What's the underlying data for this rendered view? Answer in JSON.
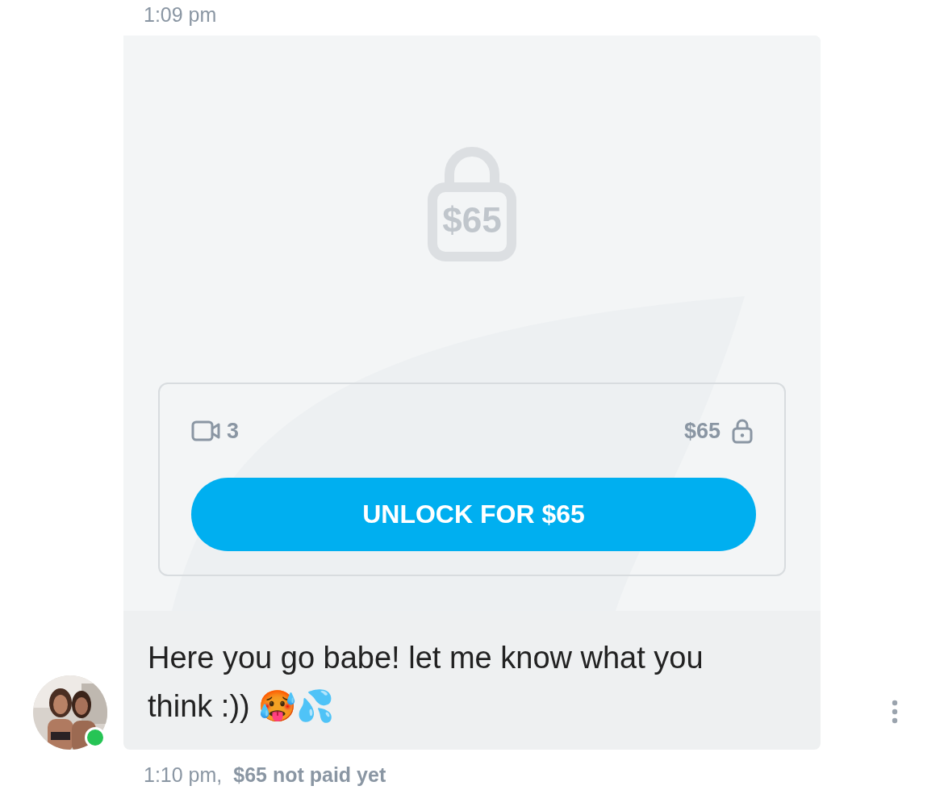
{
  "top_time": "1:09 pm",
  "locked_media": {
    "price_badge": "$65",
    "media": [
      {
        "kind": "video",
        "count": "3"
      }
    ],
    "price": "$65",
    "locked": true,
    "unlock_button": "UNLOCK FOR $65"
  },
  "message": {
    "text": "Here you go babe! let me know what you think :)) 🥵💦"
  },
  "sender": {
    "online": true
  },
  "footer": {
    "time": "1:10 pm,",
    "payment_status": "$65 not paid yet"
  }
}
